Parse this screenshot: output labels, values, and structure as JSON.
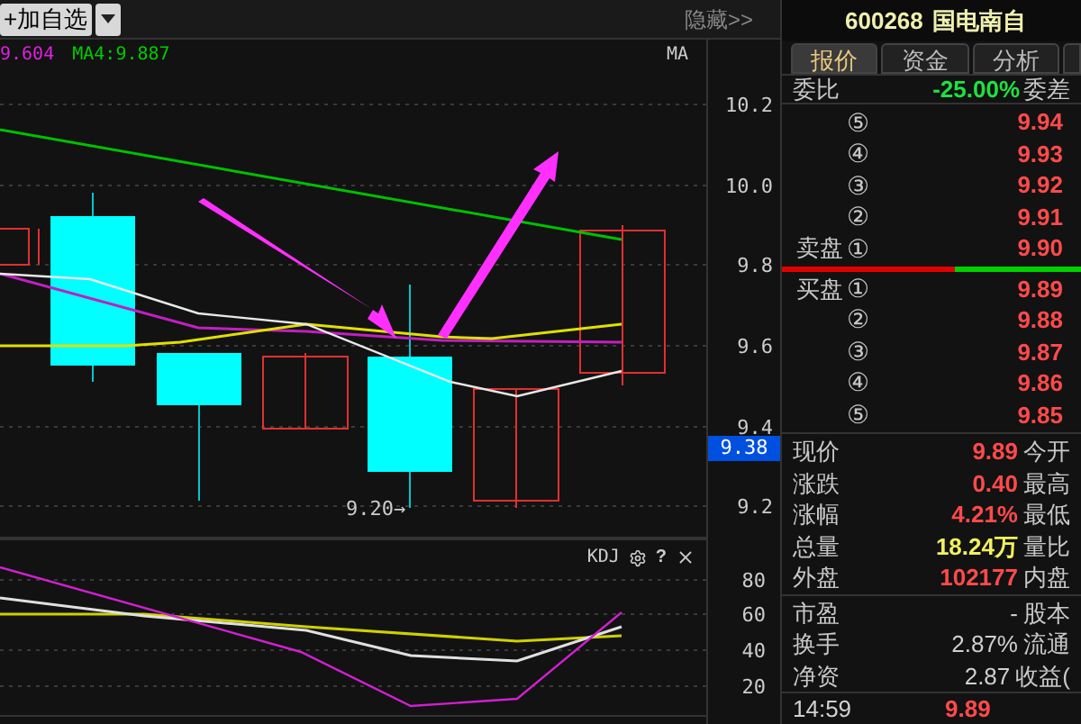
{
  "toolbar": {
    "add_button": "+加自选",
    "hide_link": "隐藏>>"
  },
  "main_chart": {
    "legend": [
      {
        "text": "9.604",
        "color": "#e020e0"
      },
      {
        "text": "MA4:9.887",
        "color": "#00cc00"
      }
    ],
    "indicator": "MA",
    "low_marker": "9.20→"
  },
  "price_axis": {
    "ticks": [
      "10.2",
      "10.0",
      "9.8",
      "9.6",
      "9.4",
      "9.2"
    ],
    "current_price": "9.38"
  },
  "kdj_panel": {
    "title": "KDJ",
    "help": "?",
    "ticks": [
      "80",
      "60",
      "40",
      "20"
    ]
  },
  "quote_panel": {
    "code": "600268",
    "name": "国电南自",
    "tabs": [
      {
        "label": "报价",
        "selected": true
      },
      {
        "label": "资金",
        "selected": false
      },
      {
        "label": "分析",
        "selected": false
      }
    ],
    "ratio": {
      "label": "委比",
      "value": "-25.00%",
      "label_right": "委差"
    },
    "asks": [
      {
        "num": "⑤",
        "price": "9.94"
      },
      {
        "num": "④",
        "price": "9.93"
      },
      {
        "num": "③",
        "price": "9.92"
      },
      {
        "num": "②",
        "price": "9.91"
      },
      {
        "prefix": "卖盘",
        "num": "①",
        "price": "9.90"
      }
    ],
    "bids": [
      {
        "prefix": "买盘",
        "num": "①",
        "price": "9.89"
      },
      {
        "num": "②",
        "price": "9.88"
      },
      {
        "num": "③",
        "price": "9.87"
      },
      {
        "num": "④",
        "price": "9.86"
      },
      {
        "num": "⑤",
        "price": "9.85"
      }
    ],
    "stats": [
      {
        "label": "现价",
        "value": "9.89",
        "color": "#ff4a4a",
        "label_right": "今开"
      },
      {
        "label": "涨跌",
        "value": "0.40",
        "color": "#ff4a4a",
        "label_right": "最高"
      },
      {
        "label": "涨幅",
        "value": "4.21%",
        "color": "#ff4a4a",
        "label_right": "最低"
      },
      {
        "label": "总量",
        "value": "18.24万",
        "color": "#f0f060",
        "label_right": "量比"
      },
      {
        "label": "外盘",
        "value": "102177",
        "color": "#ff4a4a",
        "label_right": "内盘"
      }
    ],
    "fundamentals": [
      {
        "label": "市盈",
        "value": "-",
        "label_right": "股本"
      },
      {
        "label": "换手",
        "value": "2.87%",
        "label_right": "流通"
      },
      {
        "label": "净资",
        "value": "2.87",
        "label_right": "收益("
      }
    ],
    "footer": {
      "time": "14:59",
      "price": "9.89"
    }
  }
}
